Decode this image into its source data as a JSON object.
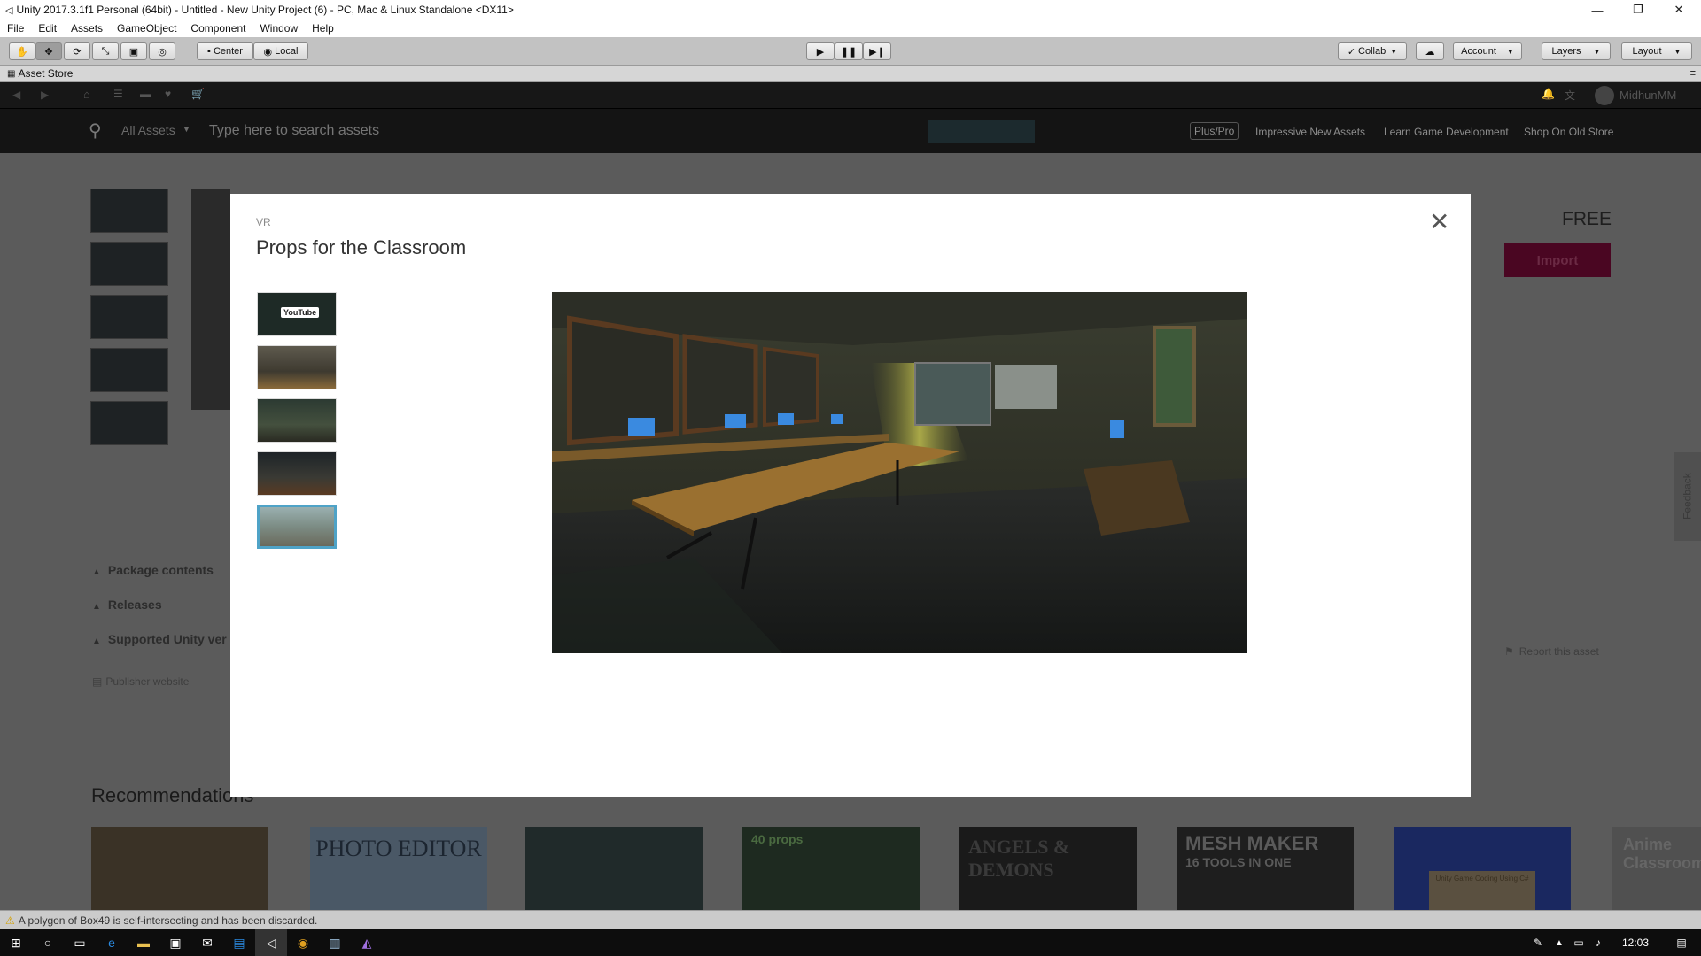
{
  "window": {
    "title": "Unity 2017.3.1f1 Personal (64bit) - Untitled - New Unity Project (6) - PC, Mac & Linux Standalone <DX11>",
    "minimize_glyph": "—",
    "restore_glyph": "❐",
    "close_glyph": "✕"
  },
  "menu": {
    "items": [
      "File",
      "Edit",
      "Assets",
      "GameObject",
      "Component",
      "Window",
      "Help"
    ]
  },
  "toolbar": {
    "pivot_center": "Center",
    "pivot_local": "Local",
    "collab": "Collab",
    "account": "Account",
    "layers": "Layers",
    "layout": "Layout"
  },
  "tab": {
    "label": "Asset Store",
    "menu_glyph": "≡"
  },
  "store": {
    "user": "MidhunMM",
    "search_category": "All Assets",
    "search_placeholder": "Type here to search assets",
    "links": [
      "Plus/Pro",
      "Impressive New Assets",
      "Learn Game Development",
      "Shop On Old Store"
    ]
  },
  "background_page": {
    "price": "FREE",
    "import_label": "Import",
    "package_contents": "Package contents",
    "releases": "Releases",
    "supported_unity": "Supported Unity ver",
    "publisher_website": "Publisher website",
    "report": "Report this asset",
    "recommendations": "Recommendations",
    "feedback": "Feedback",
    "rec_photo_editor": "PHOTO EDITOR",
    "rec_40_props": "40 props",
    "rec_angels": "ANGELS & DEMONS",
    "rec_mesh_maker": "MESH MAKER",
    "rec_mesh_tools": "16 TOOLS IN ONE",
    "rec_anime": "Anime Classroom",
    "rec_unity_book": "Unity Game Coding Using C#"
  },
  "modal": {
    "category": "VR",
    "title": "Props for the Classroom",
    "close_glyph": "✕",
    "thumb_youtube": "YouTube"
  },
  "status": {
    "message": "A polygon of Box49 is self-intersecting and has been discarded."
  },
  "taskbar": {
    "time": "12:03"
  },
  "colors": {
    "toolbar": "#c2c2c2",
    "import_button": "#a3053f",
    "selected_thumb_border": "#4fa3c7",
    "backdrop": "#5b5b5b"
  }
}
